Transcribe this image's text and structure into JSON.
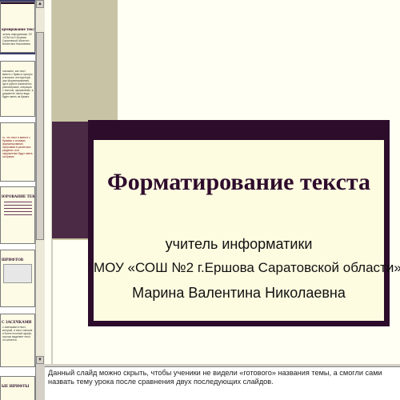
{
  "thumbnails": [
    {
      "title": "ормирование текста",
      "text": "читель информатики, ОУ «СОШ №2 г.Ершова Саратовской области», Валентина Николаевна"
    },
    {
      "title": "",
      "text": "положить, как текст вместе с буквы и пропуск в выпуске, инструкторы (как форматирование), где в работе изменяется разнообразие, операции с текстом, оформление, в документе такого вида будет иметь на бумаге."
    },
    {
      "title": "",
      "text": "то, что текст в вместе с буквами и словами, форматирование, программа в различных разделах, или оформления будут иметь на бумаге."
    },
    {
      "title": "ЮРОВАНИЕ ТЕКСТА",
      "text": ""
    },
    {
      "title": "ШРИФТОВ",
      "text": ""
    },
    {
      "title": "С ЗАСЕЧКАМИ",
      "text": "с засечками в текст, который, и текст сначала и более плотный шрифт, хорошо выделяет текст, он читается."
    },
    {
      "title": "ЫЕ ШРИФТЫ",
      "text": ""
    }
  ],
  "slide": {
    "title": "Форматирование текста",
    "line1": "учитель информатики",
    "line2": "МОУ «СОШ №2 г.Ершова  Саратовской области»",
    "line3": "Марина Валентина Николаевна"
  },
  "notes": {
    "text": "Данный слайд можно скрыть, чтобы ученики не видели «готового» названия темы, а смогли сами назвать тему урока после сравнения двух последующих слайдов."
  },
  "colors": {
    "slide_frame": "#2c0c2a",
    "slide_background": "#fdfbe0",
    "title_color": "#2e0b2c",
    "accent_panel": "#c8c3a4"
  },
  "icons": [
    "scroll-up-arrow-icon",
    "scroll-down-arrow-icon"
  ]
}
